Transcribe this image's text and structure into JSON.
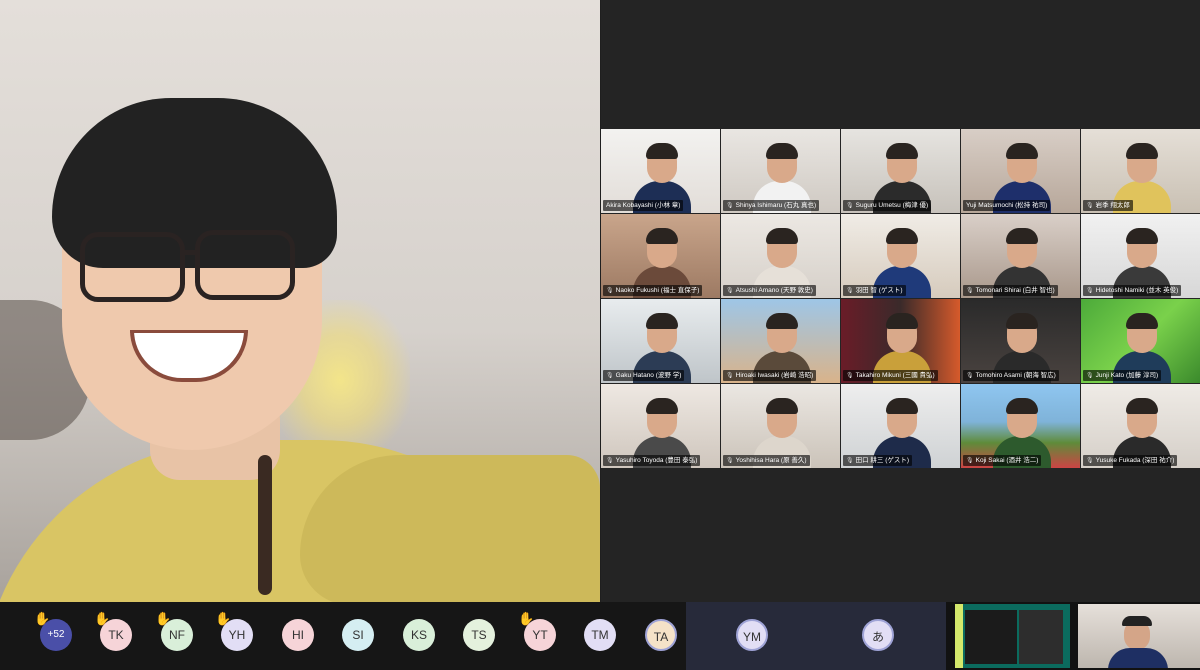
{
  "speaker": {
    "description_label": ""
  },
  "gallery": {
    "participants": [
      {
        "name": "Akira Kobayashi (小林 章)",
        "muted": false
      },
      {
        "name": "Shinya Ishimaru (石丸 真也)",
        "muted": true
      },
      {
        "name": "Suguru Umetsu (梅津 優)",
        "muted": true
      },
      {
        "name": "Yuji Matsumochi (松持 祐司)",
        "muted": false
      },
      {
        "name": "岩季 翔太郎",
        "muted": true
      },
      {
        "name": "Naoko Fukushi (福士 直保子)",
        "muted": true
      },
      {
        "name": "Atsushi Amano (天野 敦史)",
        "muted": true
      },
      {
        "name": "羽田 智 (ゲスト)",
        "muted": true
      },
      {
        "name": "Tomonari Shirai (白井 智也)",
        "muted": true
      },
      {
        "name": "Hidetoshi Namiki (並木 英俊)",
        "muted": true
      },
      {
        "name": "Gaku Hatano (波野 学)",
        "muted": true
      },
      {
        "name": "Hiroaki Iwasaki (岩崎 浩昭)",
        "muted": true
      },
      {
        "name": "Takahiro Mikuni (三國 貴弘)",
        "muted": true
      },
      {
        "name": "Tomohiro Asami (朝海 智広)",
        "muted": true
      },
      {
        "name": "Junji Kato (加藤 淳司)",
        "muted": true
      },
      {
        "name": "Yasuhiro Toyoda (豊田 泰弘)",
        "muted": true
      },
      {
        "name": "Yoshihisa Hara (原 善久)",
        "muted": true
      },
      {
        "name": "田口 耕三 (ゲスト)",
        "muted": true
      },
      {
        "name": "Koji Sakai (酒井 浩二)",
        "muted": true
      },
      {
        "name": "Yusuke Fukada (深田 祐介)",
        "muted": true
      }
    ]
  },
  "strip": {
    "more_count": "+52",
    "avatars": [
      {
        "initials": "TK",
        "hand": true,
        "color": "#f6d4d8"
      },
      {
        "initials": "NF",
        "hand": true,
        "color": "#d9efd9"
      },
      {
        "initials": "YH",
        "hand": true,
        "color": "#e2def5"
      },
      {
        "initials": "HI",
        "hand": false,
        "color": "#f6d4d8"
      },
      {
        "initials": "SI",
        "hand": false,
        "color": "#d5eef2"
      },
      {
        "initials": "KS",
        "hand": false,
        "color": "#d9efd9"
      },
      {
        "initials": "TS",
        "hand": false,
        "color": "#e4f1dd"
      },
      {
        "initials": "YT",
        "hand": true,
        "color": "#f6d4d8"
      },
      {
        "initials": "TM",
        "hand": false,
        "color": "#e2def5"
      },
      {
        "initials": "TA",
        "hand": false,
        "color": "#f5e2c8"
      }
    ],
    "pinned": [
      {
        "initials": "YM",
        "color": "#e2def5"
      },
      {
        "initials": "あ",
        "color": "#e2def5"
      }
    ]
  },
  "colors": {
    "accent": "#4a4fa8",
    "active_border": "#f3d34a",
    "hand": "#f2c84b"
  },
  "icons": {
    "hand": "raised-hand-icon",
    "mic": "mic-off-icon"
  }
}
